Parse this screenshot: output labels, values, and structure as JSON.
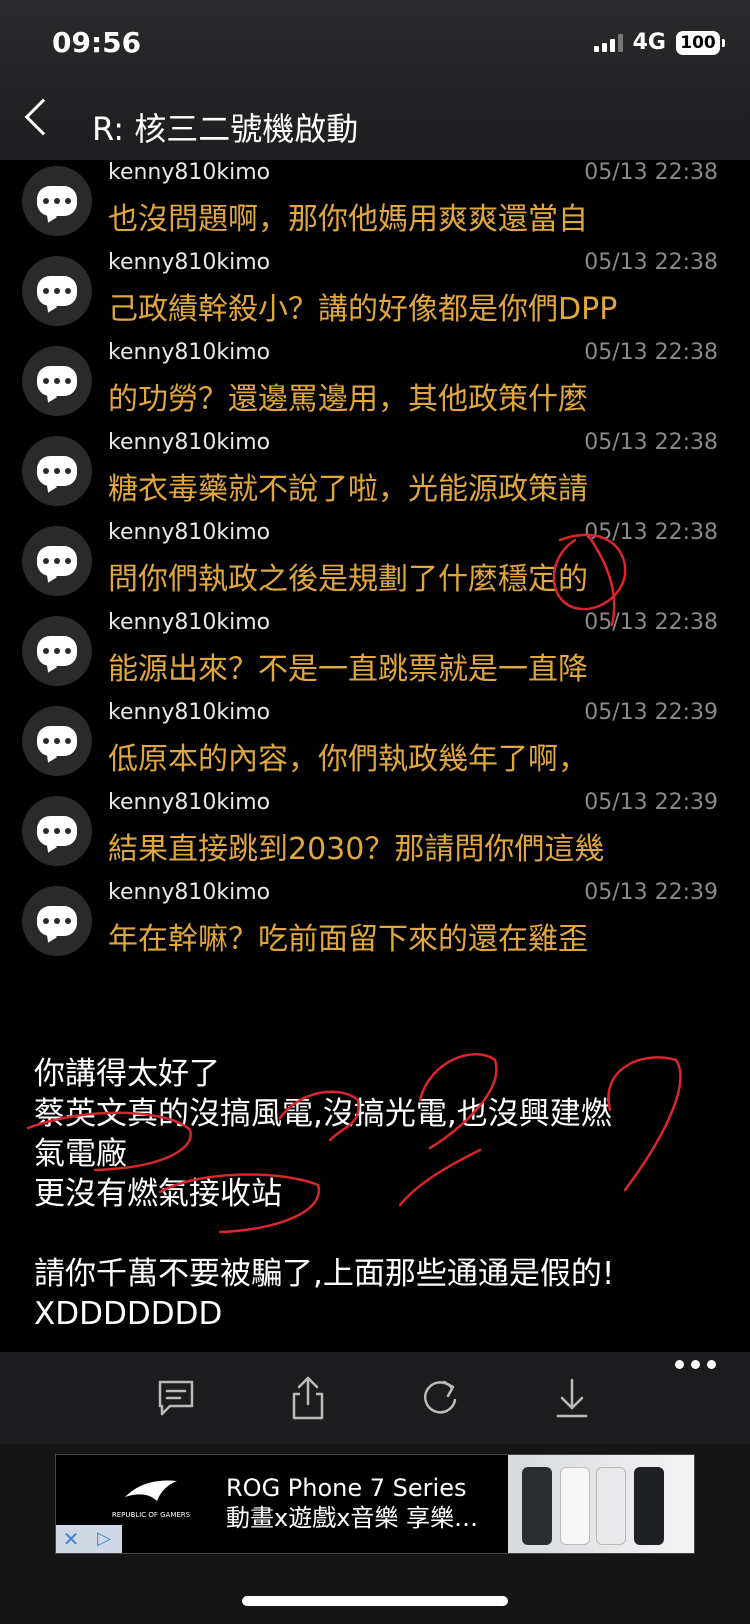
{
  "status_bar": {
    "time": "09:56",
    "network": "4G",
    "battery": "100"
  },
  "nav": {
    "title": "R: 核三二號機啟動"
  },
  "comments": [
    {
      "author": "kenny810kimo",
      "time": "05/13 22:38",
      "text": "也沒問題啊，那你他媽用爽爽還當自"
    },
    {
      "author": "kenny810kimo",
      "time": "05/13 22:38",
      "text": "己政績幹殺小？講的好像都是你們DPP"
    },
    {
      "author": "kenny810kimo",
      "time": "05/13 22:38",
      "text": "的功勞？還邊罵邊用，其他政策什麼"
    },
    {
      "author": "kenny810kimo",
      "time": "05/13 22:38",
      "text": "糖衣毒藥就不說了啦，光能源政策請"
    },
    {
      "author": "kenny810kimo",
      "time": "05/13 22:38",
      "text": "問你們執政之後是規劃了什麼穩定的"
    },
    {
      "author": "kenny810kimo",
      "time": "05/13 22:38",
      "text": "能源出來？不是一直跳票就是一直降"
    },
    {
      "author": "kenny810kimo",
      "time": "05/13 22:39",
      "text": "低原本的內容，你們執政幾年了啊，"
    },
    {
      "author": "kenny810kimo",
      "time": "05/13 22:39",
      "text": "結果直接跳到2030？那請問你們這幾"
    },
    {
      "author": "kenny810kimo",
      "time": "05/13 22:39",
      "text": "年在幹嘛？吃前面留下來的還在雞歪"
    }
  ],
  "post": {
    "lines": [
      "你講得太好了",
      "蔡英文真的沒搞風電,沒搞光電,也沒興建燃",
      "氣電廠",
      "更沒有燃氣接收站",
      "請你千萬不要被騙了,上面那些通通是假的!",
      "XDDDDDDD"
    ]
  },
  "toolbar": {
    "icons": [
      "comment-icon",
      "share-icon",
      "refresh-icon",
      "download-icon",
      "more-icon"
    ]
  },
  "ad": {
    "line1": "ROG Phone 7 Series",
    "line2": "動畫x遊戲x音樂 享樂…",
    "logo_text": "REPUBLIC OF GAMERS",
    "close": "✕",
    "info": "▷"
  },
  "colors": {
    "comment_text": "#e0a73e",
    "annotation": "#d9262c"
  }
}
